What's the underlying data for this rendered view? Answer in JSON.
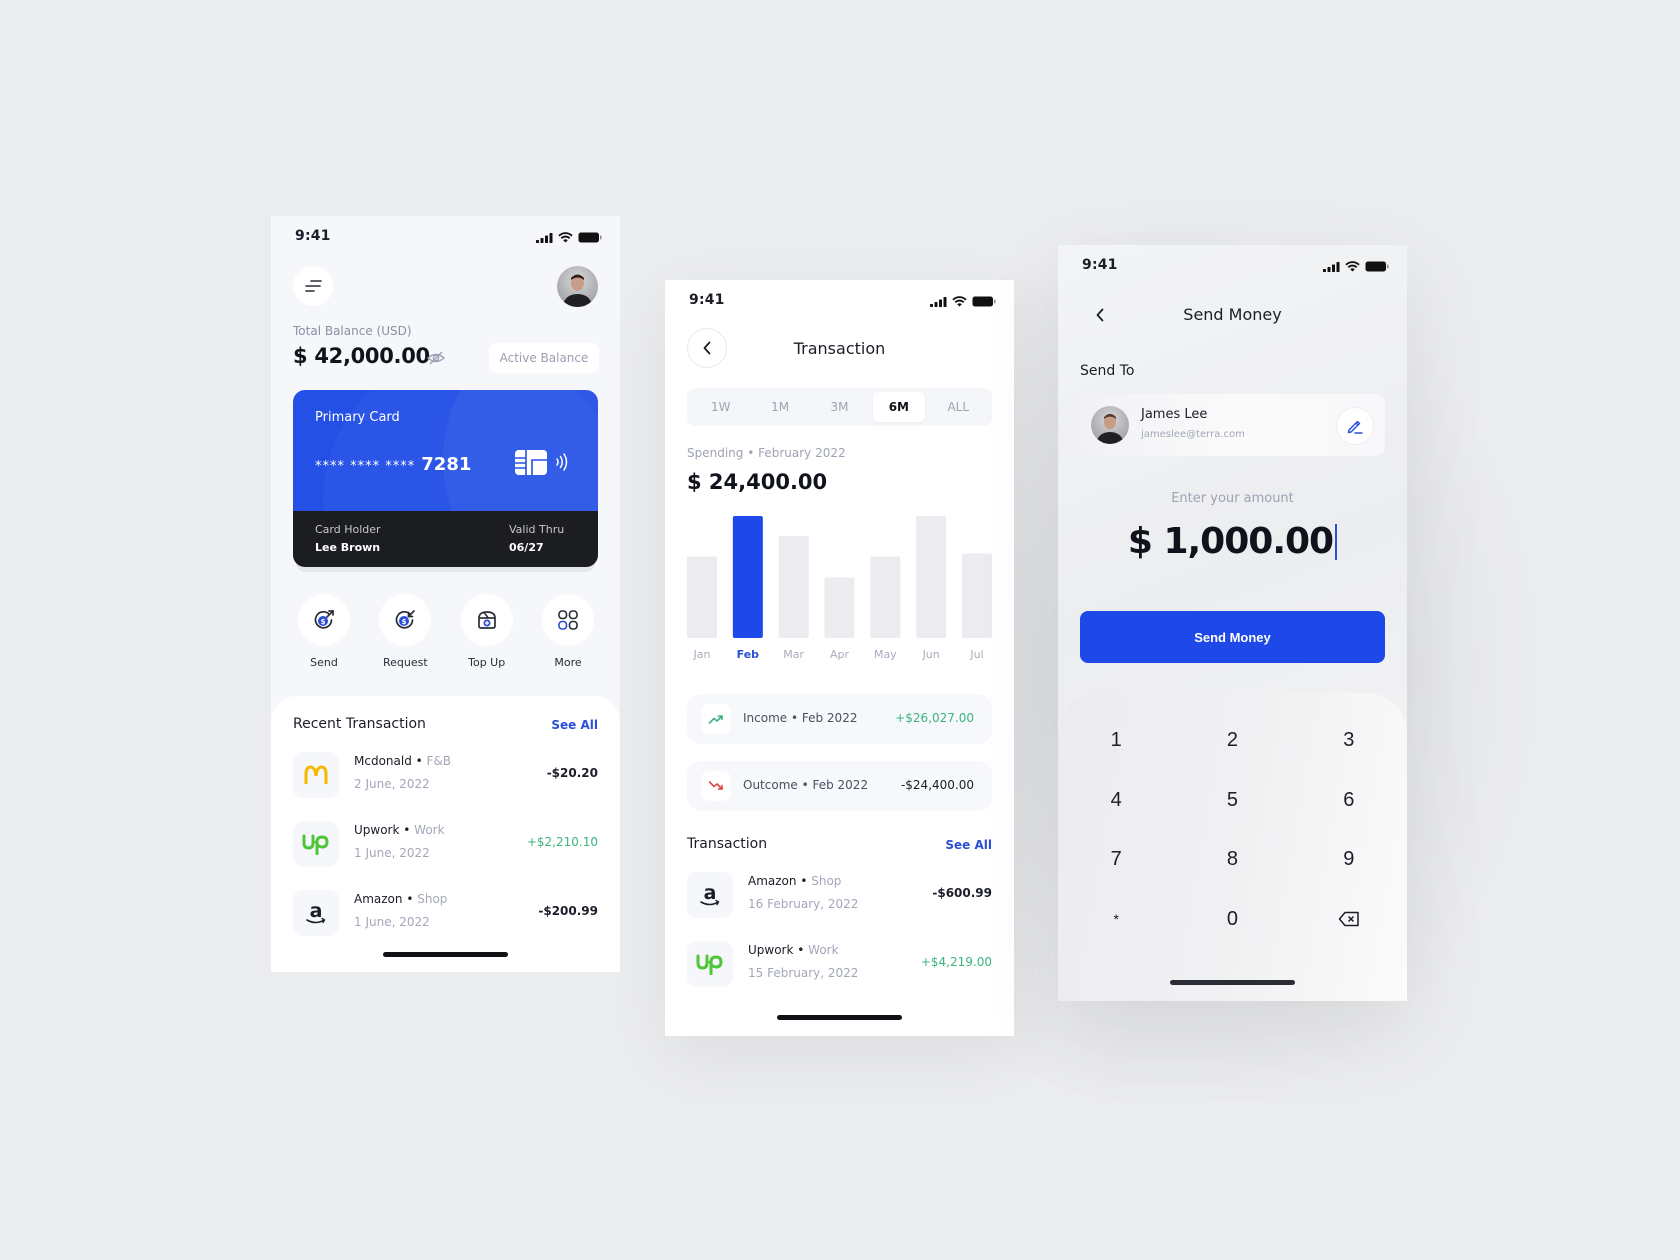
{
  "status_bar": {
    "time": "9:41"
  },
  "home_screen": {
    "balance_label": "Total Balance (USD)",
    "balance_value": "$ 42,000.00",
    "active_balance_label": "Active Balance",
    "card": {
      "title": "Primary Card",
      "masked": "**** **** ****",
      "last4": "7281",
      "holder_label": "Card Holder",
      "holder_name": "Lee Brown",
      "valid_label": "Valid Thru",
      "valid_value": "06/27",
      "color_top": "#2450e6",
      "color_bottom": "#1c1d21"
    },
    "actions": [
      {
        "label": "Send",
        "icon": "send-money-icon"
      },
      {
        "label": "Request",
        "icon": "request-money-icon"
      },
      {
        "label": "Top Up",
        "icon": "top-up-icon"
      },
      {
        "label": "More",
        "icon": "grid-icon"
      }
    ],
    "recent_title": "Recent Transaction",
    "see_all": "See All",
    "transactions": [
      {
        "name": "Mcdonald",
        "category": "F&B",
        "date": "2 June, 2022",
        "amount": "-$20.20",
        "type": "debit",
        "logo": "mcdonalds-logo"
      },
      {
        "name": "Upwork",
        "category": "Work",
        "date": "1 June, 2022",
        "amount": "+$2,210.10",
        "type": "credit",
        "logo": "upwork-logo"
      },
      {
        "name": "Amazon",
        "category": "Shop",
        "date": "1 June, 2022",
        "amount": "-$200.99",
        "type": "debit",
        "logo": "amazon-logo"
      }
    ]
  },
  "transaction_screen": {
    "title": "Transaction",
    "periods": [
      "1W",
      "1M",
      "3M",
      "6M",
      "ALL"
    ],
    "active_period": "6M",
    "spending_label": "Spending • February 2022",
    "spending_value": "$ 24,400.00",
    "income": {
      "label": "Income • Feb 2022",
      "amount": "+$26,027.00"
    },
    "outcome": {
      "label": "Outcome • Feb 2022",
      "amount": "-$24,400.00"
    },
    "list_title": "Transaction",
    "see_all": "See All",
    "transactions": [
      {
        "name": "Amazon",
        "category": "Shop",
        "date": "16 February, 2022",
        "amount": "-$600.99",
        "type": "debit",
        "logo": "amazon-logo"
      },
      {
        "name": "Upwork",
        "category": "Work",
        "date": "15 February, 2022",
        "amount": "+$4,219.00",
        "type": "credit",
        "logo": "upwork-logo"
      }
    ]
  },
  "chart_data": {
    "type": "bar",
    "title": "Spending • February 2022",
    "categories": [
      "Jan",
      "Feb",
      "Mar",
      "Apr",
      "May",
      "Jun",
      "Jul"
    ],
    "values": [
      16300,
      24400,
      20400,
      12100,
      16300,
      24400,
      16900
    ],
    "highlighted": "Feb",
    "xlabel": "",
    "ylabel": "",
    "ylim": [
      0,
      24400
    ],
    "grid": false,
    "colors": {
      "bar": "#ececf0",
      "highlight": "#1e48e8",
      "label": "#a8acbd",
      "label_active": "#2a4fd6"
    }
  },
  "send_screen": {
    "title": "Send Money",
    "send_to_label": "Send To",
    "recipient_name": "James Lee",
    "recipient_email": "jameslee@terra.com",
    "amount_label": "Enter your amount",
    "amount_value": "$ 1,000.00",
    "send_button": "Send  Money",
    "keys": [
      "1",
      "2",
      "3",
      "4",
      "5",
      "6",
      "7",
      "8",
      "9",
      "*",
      "0",
      "backspace"
    ]
  },
  "colors": {
    "accent": "#1e48e8",
    "positive": "#3cb47e",
    "negative": "#e04545",
    "link": "#2a4fd6"
  }
}
